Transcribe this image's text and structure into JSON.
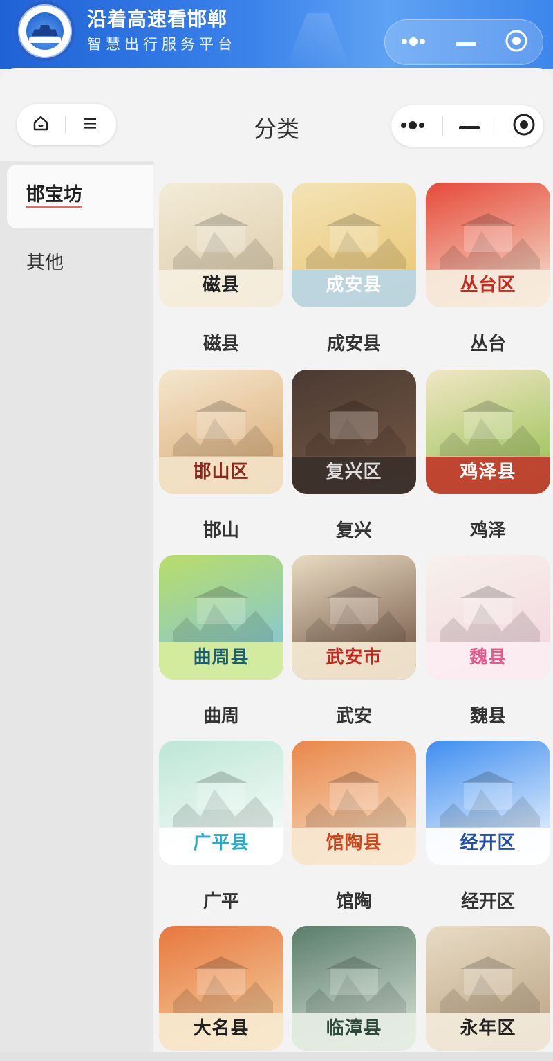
{
  "header": {
    "app_title": "沿着高速看邯郸",
    "app_subtitle": "智慧出行服务平台"
  },
  "nav": {
    "home_icon": "home-icon",
    "menu_icon": "menu-icon",
    "page_title": "分类"
  },
  "sidebar": {
    "items": [
      {
        "label": "邯宝坊",
        "active": true
      },
      {
        "label": "其他",
        "active": false
      }
    ]
  },
  "grid": {
    "tiles": [
      {
        "image_title": "磁县",
        "caption": "磁县",
        "bg": [
          "#f4ecd8",
          "#d9c8a6"
        ],
        "title_color": "#222222",
        "title_bg": "#f6efe0"
      },
      {
        "image_title": "成安县",
        "caption": "成安县",
        "bg": [
          "#f3e3b6",
          "#e9c46d"
        ],
        "title_color": "#ffffff",
        "title_bg": "#b7d6e6"
      },
      {
        "image_title": "丛台区",
        "caption": "丛台",
        "bg": [
          "#e64a3a",
          "#f6e8d6"
        ],
        "title_color": "#c8281e",
        "title_bg": "#f6ebdc"
      },
      {
        "image_title": "邯山区",
        "caption": "邯山",
        "bg": [
          "#f5e7cf",
          "#d8a56b"
        ],
        "title_color": "#8a2a1e",
        "title_bg": "#f3e3c8"
      },
      {
        "image_title": "复兴区",
        "caption": "复兴",
        "bg": [
          "#4a3a33",
          "#7a5a44"
        ],
        "title_color": "#dedede",
        "title_bg": "#3a2f2a"
      },
      {
        "image_title": "鸡泽县",
        "caption": "鸡泽",
        "bg": [
          "#f2e6c6",
          "#8fbf4a"
        ],
        "title_color": "#ffffff",
        "title_bg": "#c0392b"
      },
      {
        "image_title": "曲周县",
        "caption": "曲周",
        "bg": [
          "#b9dd6a",
          "#7cc3e8"
        ],
        "title_color": "#1b5e6e",
        "title_bg": "#d8ee9a"
      },
      {
        "image_title": "武安市",
        "caption": "武安",
        "bg": [
          "#e9dcc3",
          "#6a4a3a"
        ],
        "title_color": "#c0281e",
        "title_bg": "#f6ead4"
      },
      {
        "image_title": "魏县",
        "caption": "魏县",
        "bg": [
          "#f7f1ec",
          "#f3d4de"
        ],
        "title_color": "#e45b8c",
        "title_bg": "#fbeef2"
      },
      {
        "image_title": "广平县",
        "caption": "广平",
        "bg": [
          "#bde6d6",
          "#ffffff"
        ],
        "title_color": "#2aa7c9",
        "title_bg": "#ffffff"
      },
      {
        "image_title": "馆陶县",
        "caption": "馆陶",
        "bg": [
          "#e9874a",
          "#f8e7d0"
        ],
        "title_color": "#c9481e",
        "title_bg": "#f8e7d0"
      },
      {
        "image_title": "经开区",
        "caption": "经开区",
        "bg": [
          "#3f8ef0",
          "#ffffff"
        ],
        "title_color": "#1f4fa8",
        "title_bg": "#ffffff"
      },
      {
        "image_title": "大名县",
        "caption": "",
        "bg": [
          "#e8773f",
          "#f4d6a6"
        ],
        "title_color": "#222222",
        "title_bg": "#f7e9cf"
      },
      {
        "image_title": "临漳县",
        "caption": "",
        "bg": [
          "#5a7d6a",
          "#dfe7dd"
        ],
        "title_color": "#2f4a3c",
        "title_bg": "#e6eee4"
      },
      {
        "image_title": "永年区",
        "caption": "",
        "bg": [
          "#e8dcc6",
          "#b8a07e"
        ],
        "title_color": "#222222",
        "title_bg": "#f3eadb"
      }
    ]
  }
}
